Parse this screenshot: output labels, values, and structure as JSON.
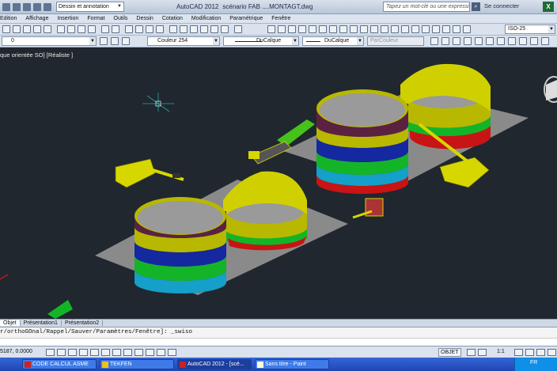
{
  "titlebar": {
    "workspace": "Dessin et annotation",
    "app_title": "AutoCAD 2012",
    "file_name": "scénario FAB ....MONTAGT.dwg",
    "search_placeholder": "Tapez un mot-clé ou une expressio",
    "sign_in": "Se connecter",
    "excel_icon_letter": "X"
  },
  "menu": [
    "Edition",
    "Affichage",
    "Insertion",
    "Format",
    "Outils",
    "Dessin",
    "Cotation",
    "Modification",
    "Paramétrique",
    "Fenêtre"
  ],
  "toolbar2": {
    "layer_value": "0",
    "color_value": "Couleur 254",
    "linetype_value": "DuCalque",
    "lineweight_value": "DuCalque",
    "plotstyle_value": "ParCouleur",
    "dimstyle_value": "ISO-25"
  },
  "viewport": {
    "label": "que orientée SO] [Réaliste ]",
    "colors": {
      "background": "#20272f",
      "slab": "#8c8c8c",
      "tank_top": "#b8b800",
      "tank_band_dark": "#5a2240",
      "tank_band_blue": "#1428a0",
      "tank_band_green": "#14b428",
      "tank_band_cyan": "#14a0c8",
      "tank_band_red": "#c81414",
      "crane": "#d7d700"
    }
  },
  "tabs": [
    "Objet",
    "Présentation1",
    "Présentation2"
  ],
  "command": {
    "history": "r/orthoGOnal/Rappel/Sauver/Paramètres/Fenêtre]: _swiso"
  },
  "status": {
    "coords": "5187, 0.0000",
    "objet": "OBJET",
    "scale": "1:1"
  },
  "taskbar": {
    "buttons": [
      "CODE CALCUL ASME",
      "TEKFEN",
      "AutoCAD 2012 - [scé...",
      "Sans titre - Paint"
    ],
    "language": "FR"
  }
}
